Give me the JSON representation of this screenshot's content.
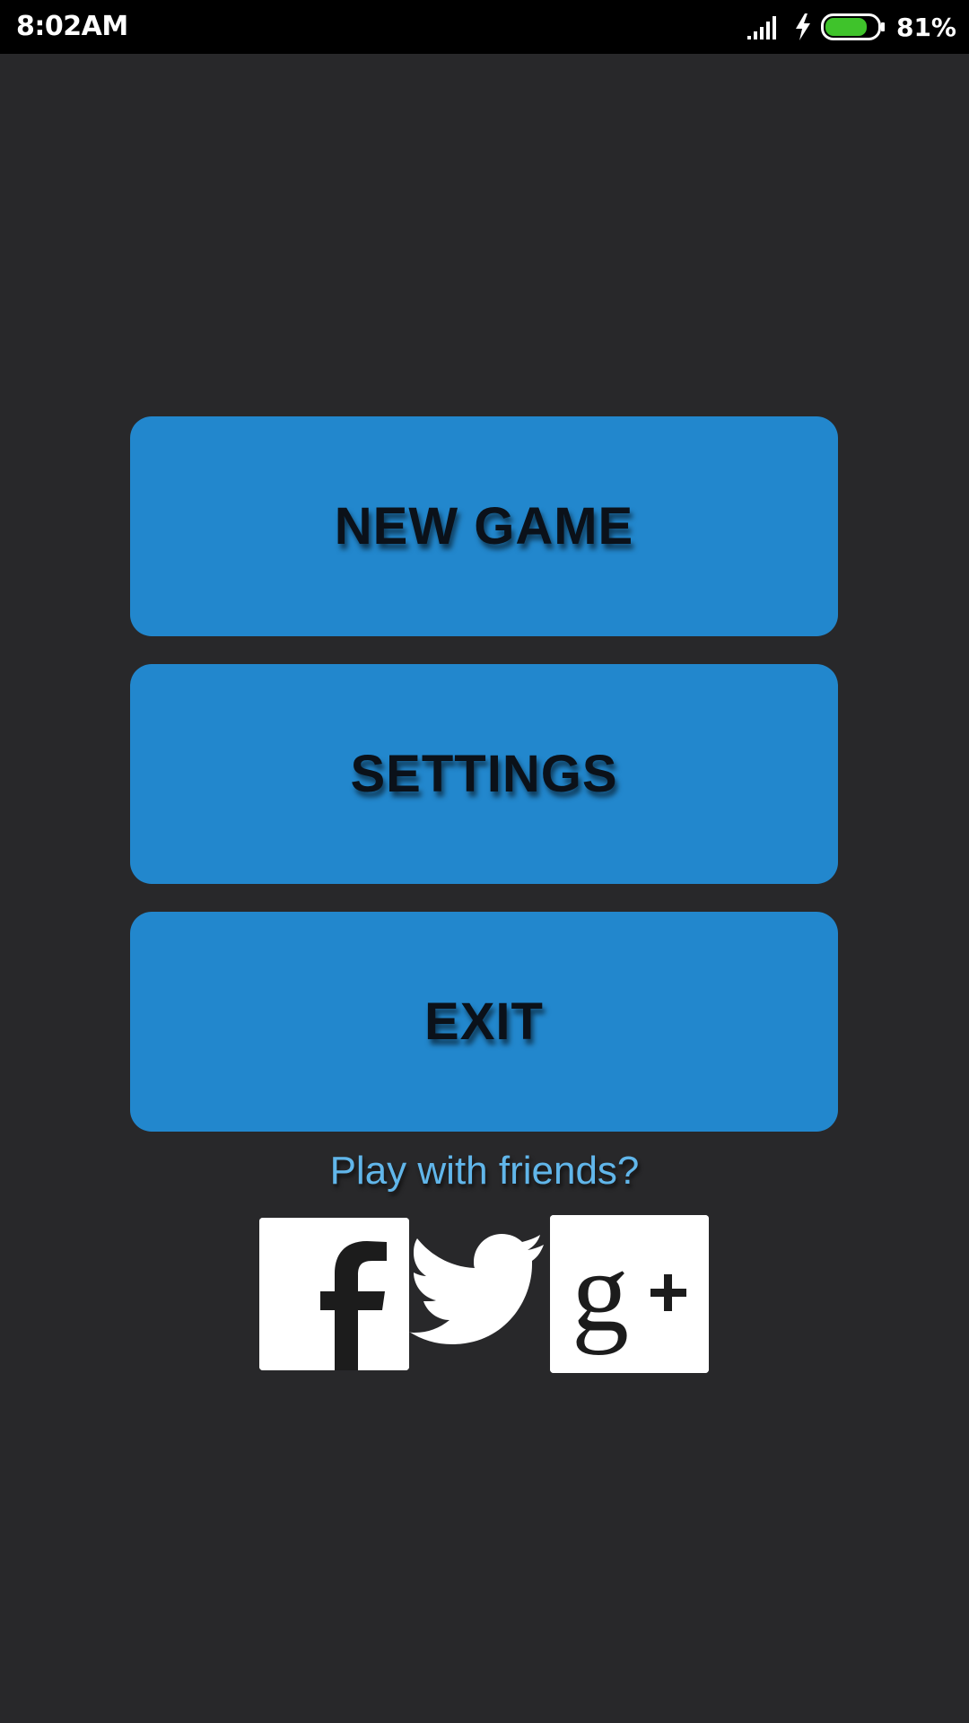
{
  "status_bar": {
    "time": "8:02AM",
    "battery_percent": "81%",
    "battery_level": 0.81,
    "icons": [
      "signal-icon",
      "charging-bolt-icon",
      "battery-icon"
    ]
  },
  "menu": {
    "new_game_label": "NEW GAME",
    "settings_label": "SETTINGS",
    "exit_label": "EXIT"
  },
  "social": {
    "prompt": "Play with friends?",
    "icons": [
      "facebook-icon",
      "twitter-icon",
      "google-plus-icon"
    ]
  },
  "colors": {
    "background": "#28282a",
    "button": "#2287cd",
    "button_text": "#0b1119",
    "prompt_text": "#61b6ea",
    "battery": "#3fc32b"
  }
}
